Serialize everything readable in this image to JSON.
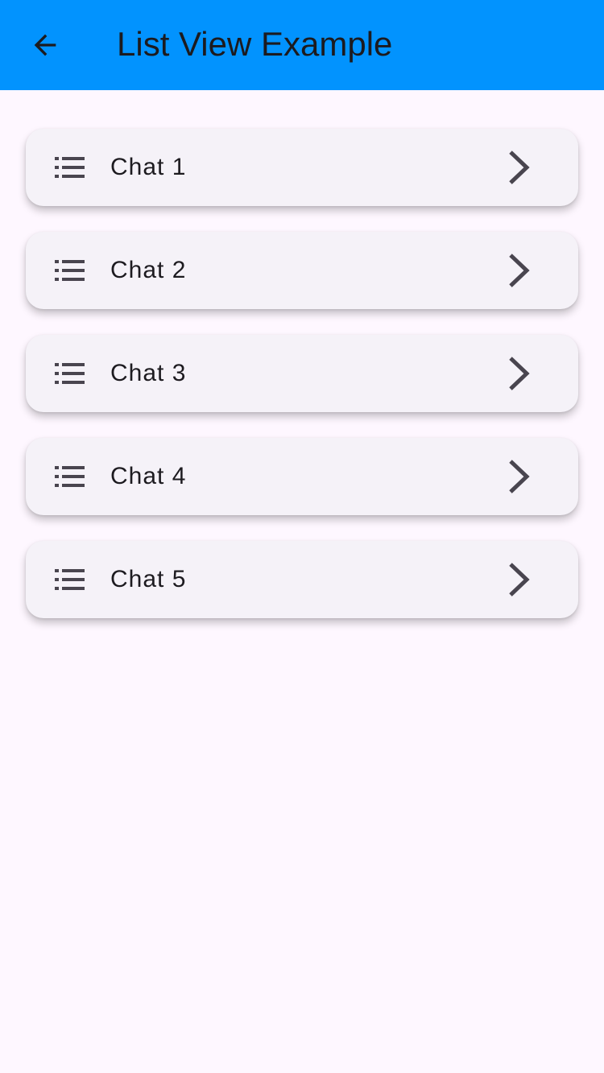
{
  "app_bar": {
    "title": "List View Example",
    "back_icon": "arrow-back-icon",
    "background": "#0293fe"
  },
  "list": {
    "items": [
      {
        "label": "Chat 1",
        "leading_icon": "list-icon",
        "trailing_icon": "chevron-right-icon"
      },
      {
        "label": "Chat 2",
        "leading_icon": "list-icon",
        "trailing_icon": "chevron-right-icon"
      },
      {
        "label": "Chat 3",
        "leading_icon": "list-icon",
        "trailing_icon": "chevron-right-icon"
      },
      {
        "label": "Chat 4",
        "leading_icon": "list-icon",
        "trailing_icon": "chevron-right-icon"
      },
      {
        "label": "Chat 5",
        "leading_icon": "list-icon",
        "trailing_icon": "chevron-right-icon"
      }
    ]
  },
  "colors": {
    "page_background": "#fef7ff",
    "card_background": "#f5f2f8",
    "icon": "#49454f",
    "text": "#1d1b20"
  }
}
